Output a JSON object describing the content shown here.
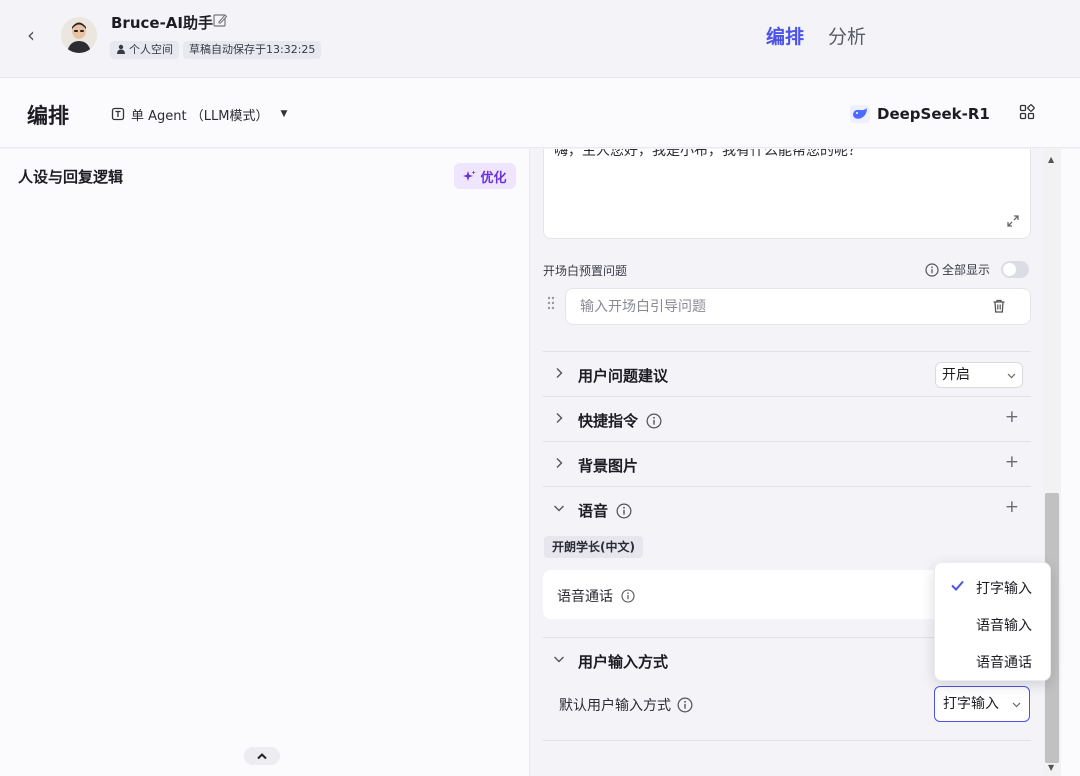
{
  "header": {
    "bot_name": "Bruce-AI助手",
    "space_label": "个人空间",
    "save_status": "草稿自动保存于13:32:25",
    "tabs": [
      {
        "label": "编排",
        "active": true
      },
      {
        "label": "分析",
        "active": false
      }
    ]
  },
  "subbar": {
    "title": "编排",
    "mode_label": "单 Agent （LLM模式）",
    "model_label": "DeepSeek-R1"
  },
  "left_panel": {
    "persona_title": "人设与回复逻辑",
    "optimize_label": "优化"
  },
  "right_panel": {
    "opening_text": "嗨，主人您好，我是小布，我有什么能帮您的呢？",
    "preset_questions_label": "开场白预置问题",
    "show_all_label": "全部显示",
    "show_all_enabled": false,
    "preset_placeholder": "输入开场白引导问题",
    "sections": [
      {
        "title": "用户问题建议",
        "select_value": "开启"
      },
      {
        "title": "快捷指令"
      },
      {
        "title": "背景图片"
      },
      {
        "title": "语音"
      },
      {
        "title": "用户输入方式"
      }
    ],
    "voice_tag": "开朗学长(中文)",
    "voice_call_label": "语音通话",
    "default_input_label": "默认用户输入方式",
    "default_input_value": "打字输入"
  },
  "dropdown": {
    "options": [
      "打字输入",
      "语音输入",
      "语音通话"
    ],
    "selected": "打字输入"
  },
  "colors": {
    "accent": "#4d53e8",
    "optimize_bg": "#efe6fd",
    "optimize_text": "#6a33d9"
  }
}
